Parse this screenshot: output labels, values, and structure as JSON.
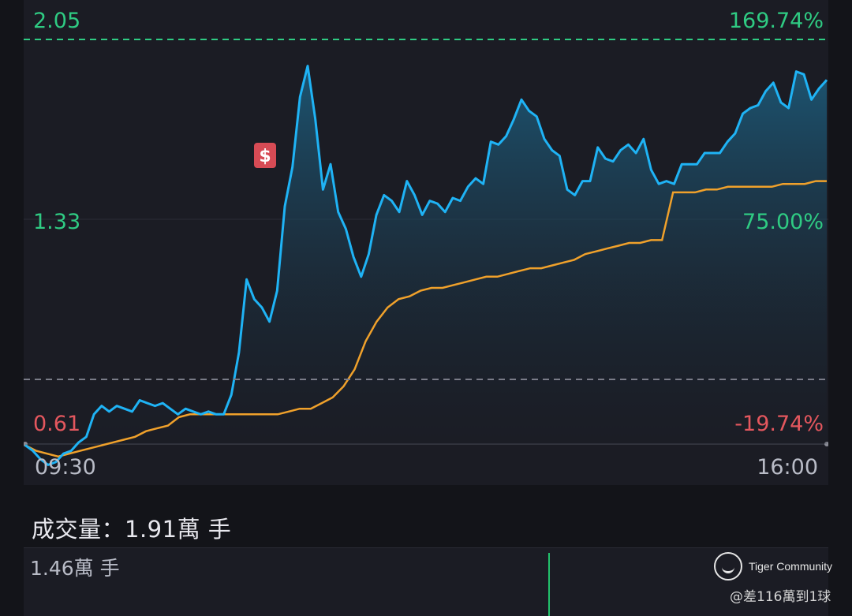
{
  "chart_data": {
    "type": "line",
    "x_ticks": [
      "09:30",
      "16:00"
    ],
    "y_left_ticks": [
      "2.05",
      "1.33",
      "0.61"
    ],
    "y_right_ticks": [
      "169.74%",
      "75.00%",
      "-19.74%"
    ],
    "ylim": [
      0.61,
      2.05
    ],
    "reference_price": 0.76,
    "reference_high": 2.05,
    "series": [
      {
        "role": "price",
        "color": "#1fb3f5",
        "values": [
          0.69,
          0.67,
          0.64,
          0.62,
          0.63,
          0.66,
          0.67,
          0.7,
          0.72,
          0.8,
          0.83,
          0.81,
          0.83,
          0.82,
          0.81,
          0.85,
          0.84,
          0.83,
          0.84,
          0.82,
          0.8,
          0.82,
          0.81,
          0.8,
          0.81,
          0.8,
          0.8,
          0.87,
          1.02,
          1.28,
          1.21,
          1.18,
          1.13,
          1.24,
          1.54,
          1.68,
          1.93,
          2.04,
          1.85,
          1.6,
          1.69,
          1.52,
          1.46,
          1.36,
          1.29,
          1.37,
          1.51,
          1.58,
          1.56,
          1.52,
          1.63,
          1.58,
          1.51,
          1.56,
          1.55,
          1.52,
          1.57,
          1.56,
          1.61,
          1.64,
          1.62,
          1.77,
          1.76,
          1.79,
          1.85,
          1.92,
          1.88,
          1.86,
          1.78,
          1.74,
          1.72,
          1.6,
          1.58,
          1.63,
          1.63,
          1.75,
          1.71,
          1.7,
          1.74,
          1.76,
          1.73,
          1.78,
          1.67,
          1.62,
          1.63,
          1.62,
          1.69,
          1.69,
          1.69,
          1.73,
          1.73,
          1.73,
          1.77,
          1.8,
          1.87,
          1.89,
          1.9,
          1.95,
          1.98,
          1.91,
          1.89,
          2.02,
          2.01,
          1.92,
          1.96,
          1.99
        ]
      },
      {
        "role": "average",
        "color": "#f0a12b",
        "values": [
          0.69,
          0.67,
          0.66,
          0.65,
          0.66,
          0.67,
          0.68,
          0.69,
          0.7,
          0.71,
          0.72,
          0.74,
          0.75,
          0.76,
          0.79,
          0.8,
          0.8,
          0.8,
          0.8,
          0.8,
          0.8,
          0.8,
          0.8,
          0.8,
          0.81,
          0.82,
          0.82,
          0.84,
          0.86,
          0.9,
          0.96,
          1.06,
          1.13,
          1.18,
          1.21,
          1.22,
          1.24,
          1.25,
          1.25,
          1.26,
          1.27,
          1.28,
          1.29,
          1.29,
          1.3,
          1.31,
          1.32,
          1.32,
          1.33,
          1.34,
          1.35,
          1.37,
          1.38,
          1.39,
          1.4,
          1.41,
          1.41,
          1.42,
          1.42,
          1.59,
          1.59,
          1.59,
          1.6,
          1.6,
          1.61,
          1.61,
          1.61,
          1.61,
          1.61,
          1.62,
          1.62,
          1.62,
          1.63,
          1.63
        ]
      }
    ]
  },
  "volume": {
    "title": "成交量：1.91萬 手",
    "max_label": "1.46萬 手"
  },
  "brand": {
    "name": "Tiger Community",
    "watermark": "@差116萬到1球"
  }
}
